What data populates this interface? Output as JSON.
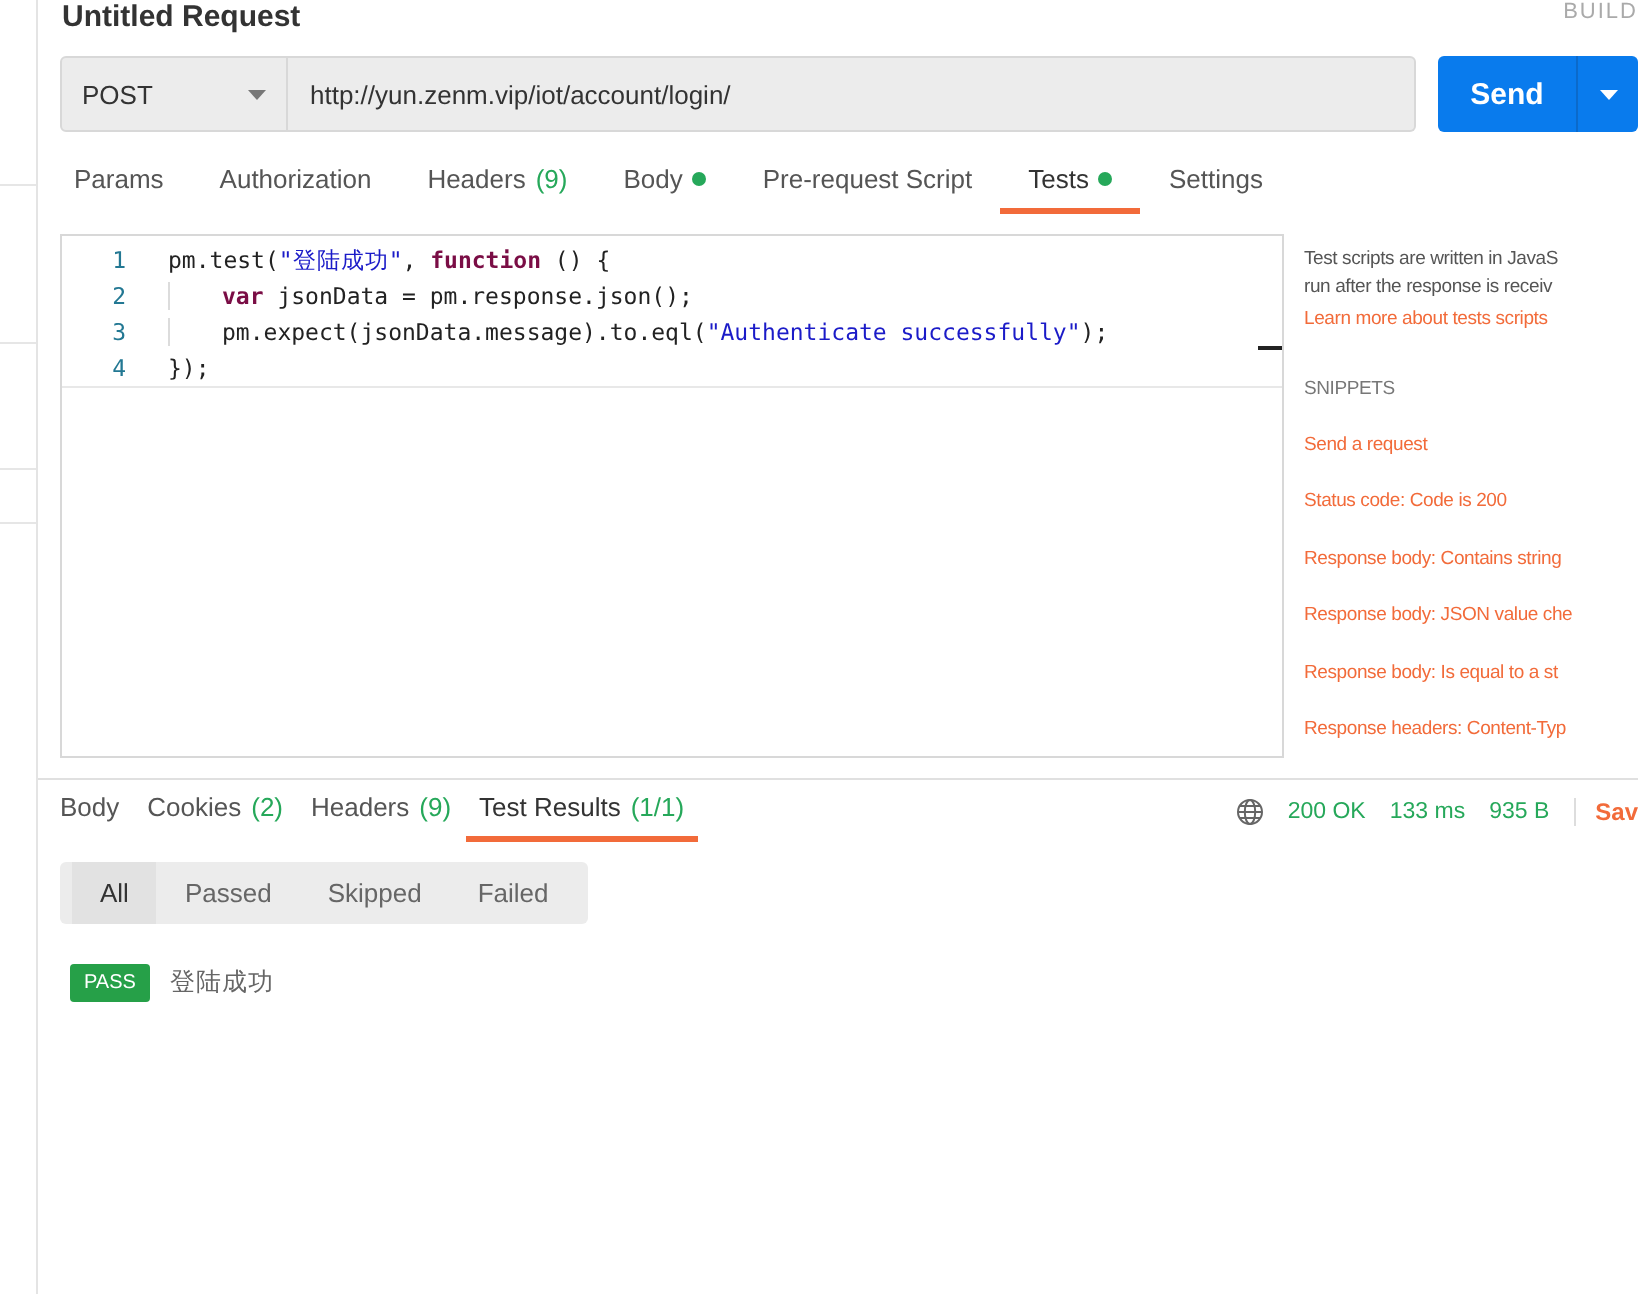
{
  "header": {
    "title": "Untitled Request",
    "build_label": "BUILD"
  },
  "request": {
    "method": "POST",
    "url": "http://yun.zenm.vip/iot/account/login/",
    "send_label": "Send"
  },
  "request_tabs": [
    {
      "label": "Params",
      "selected": false
    },
    {
      "label": "Authorization",
      "selected": false
    },
    {
      "label": "Headers",
      "count": "(9)",
      "selected": false
    },
    {
      "label": "Body",
      "dot": true,
      "selected": false
    },
    {
      "label": "Pre-request Script",
      "selected": false
    },
    {
      "label": "Tests",
      "dot": true,
      "selected": true
    },
    {
      "label": "Settings",
      "selected": false
    }
  ],
  "editor": {
    "lines": [
      {
        "number": "1",
        "indented": false,
        "segments": [
          {
            "kind": "plain",
            "text": "pm.test("
          },
          {
            "kind": "string",
            "text": "\"登陆成功\""
          },
          {
            "kind": "plain",
            "text": ", "
          },
          {
            "kind": "keyword",
            "text": "function"
          },
          {
            "kind": "plain",
            "text": " () {"
          }
        ]
      },
      {
        "number": "2",
        "indented": true,
        "segments": [
          {
            "kind": "keyword",
            "text": "var"
          },
          {
            "kind": "plain",
            "text": " jsonData = pm.response.json();"
          }
        ]
      },
      {
        "number": "3",
        "indented": true,
        "segments": [
          {
            "kind": "plain",
            "text": "pm.expect(jsonData.message).to.eql("
          },
          {
            "kind": "string",
            "text": "\"Authenticate successfully\""
          },
          {
            "kind": "plain",
            "text": ");"
          }
        ]
      },
      {
        "number": "4",
        "indented": false,
        "segments": [
          {
            "kind": "plain",
            "text": "});"
          }
        ]
      }
    ]
  },
  "help": {
    "lines": [
      "Test scripts are written in JavaS",
      "run after the response is receiv"
    ],
    "link": "Learn more about tests scripts",
    "snippets_heading": "SNIPPETS",
    "snippets": [
      "Send a request",
      "Status code: Code is 200",
      "Response body: Contains string",
      "Response body: JSON value che",
      "Response body: Is equal to a st",
      "Response headers: Content-Typ"
    ]
  },
  "response_tabs": [
    {
      "label": "Body",
      "selected": false
    },
    {
      "label": "Cookies",
      "count": "(2)",
      "selected": false
    },
    {
      "label": "Headers",
      "count": "(9)",
      "selected": false
    },
    {
      "label": "Test Results",
      "count": "(1/1)",
      "selected": true
    }
  ],
  "response_meta": {
    "status": "200 OK",
    "time": "133 ms",
    "size": "935 B",
    "save_label": "Sav"
  },
  "filters": [
    {
      "label": "All",
      "selected": true
    },
    {
      "label": "Passed",
      "selected": false
    },
    {
      "label": "Skipped",
      "selected": false
    },
    {
      "label": "Failed",
      "selected": false
    }
  ],
  "results": [
    {
      "status": "PASS",
      "name": "登陆成功"
    }
  ]
}
